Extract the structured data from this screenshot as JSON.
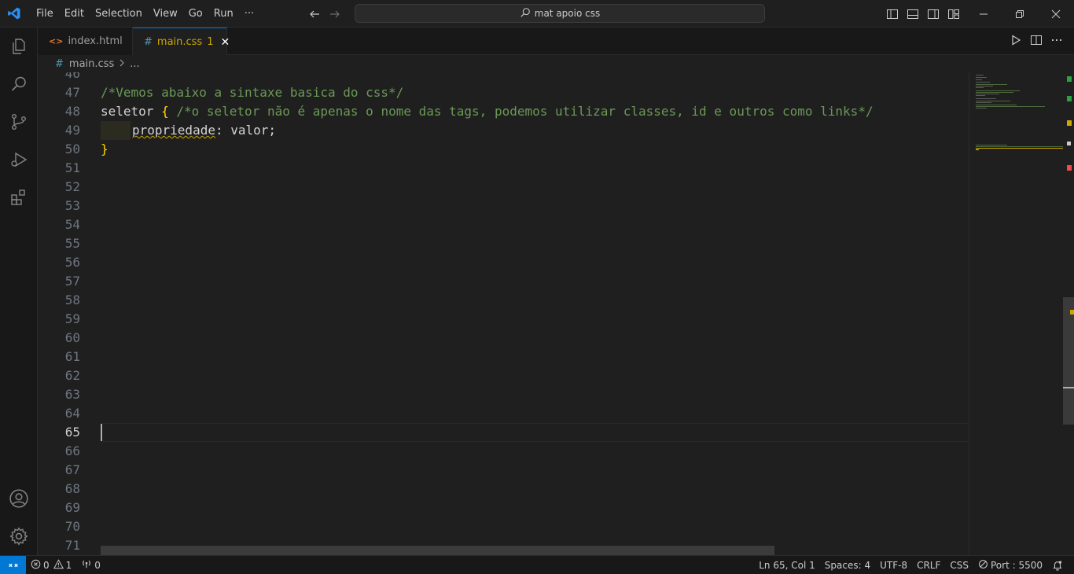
{
  "menu": {
    "items": [
      "File",
      "Edit",
      "Selection",
      "View",
      "Go",
      "Run",
      "···"
    ]
  },
  "search": {
    "text": "mat apoio css"
  },
  "tabs": [
    {
      "label": "index.html",
      "icon": "html-file-icon"
    },
    {
      "label": "main.css",
      "icon": "css-file-icon",
      "badge": "1",
      "active": true
    }
  ],
  "breadcrumb": {
    "file": "main.css",
    "rest": "..."
  },
  "editor": {
    "lines": [
      {
        "num": "46"
      },
      {
        "num": "47",
        "comment": "/*Vemos abaixo a sintaxe basica do css*/"
      },
      {
        "num": "48",
        "selector": "seletor",
        "brace": "{",
        "comment": "/*o seletor não é apenas o nome das tags, podemos utilizar classes, id e outros como links*/"
      },
      {
        "num": "49",
        "prop": "propriedade",
        "colon": ":",
        "value": "valor",
        "semi": ";"
      },
      {
        "num": "50",
        "brace": "}"
      },
      {
        "num": "51"
      },
      {
        "num": "52"
      },
      {
        "num": "53"
      },
      {
        "num": "54"
      },
      {
        "num": "55"
      },
      {
        "num": "56"
      },
      {
        "num": "57"
      },
      {
        "num": "58"
      },
      {
        "num": "59"
      },
      {
        "num": "60"
      },
      {
        "num": "61"
      },
      {
        "num": "62"
      },
      {
        "num": "63"
      },
      {
        "num": "64"
      },
      {
        "num": "65"
      },
      {
        "num": "66"
      },
      {
        "num": "67"
      },
      {
        "num": "68"
      },
      {
        "num": "69"
      },
      {
        "num": "70"
      },
      {
        "num": "71"
      }
    ],
    "current_line": "65"
  },
  "status": {
    "errors": "0",
    "warnings": "1",
    "ports": "0",
    "position": "Ln 65, Col 1",
    "spaces": "Spaces: 4",
    "encoding": "UTF-8",
    "eol": "CRLF",
    "language": "CSS",
    "port": "Port : 5500"
  },
  "colors": {
    "accent": "#0078d4",
    "warning": "#cca700",
    "comment": "#6a9955"
  }
}
